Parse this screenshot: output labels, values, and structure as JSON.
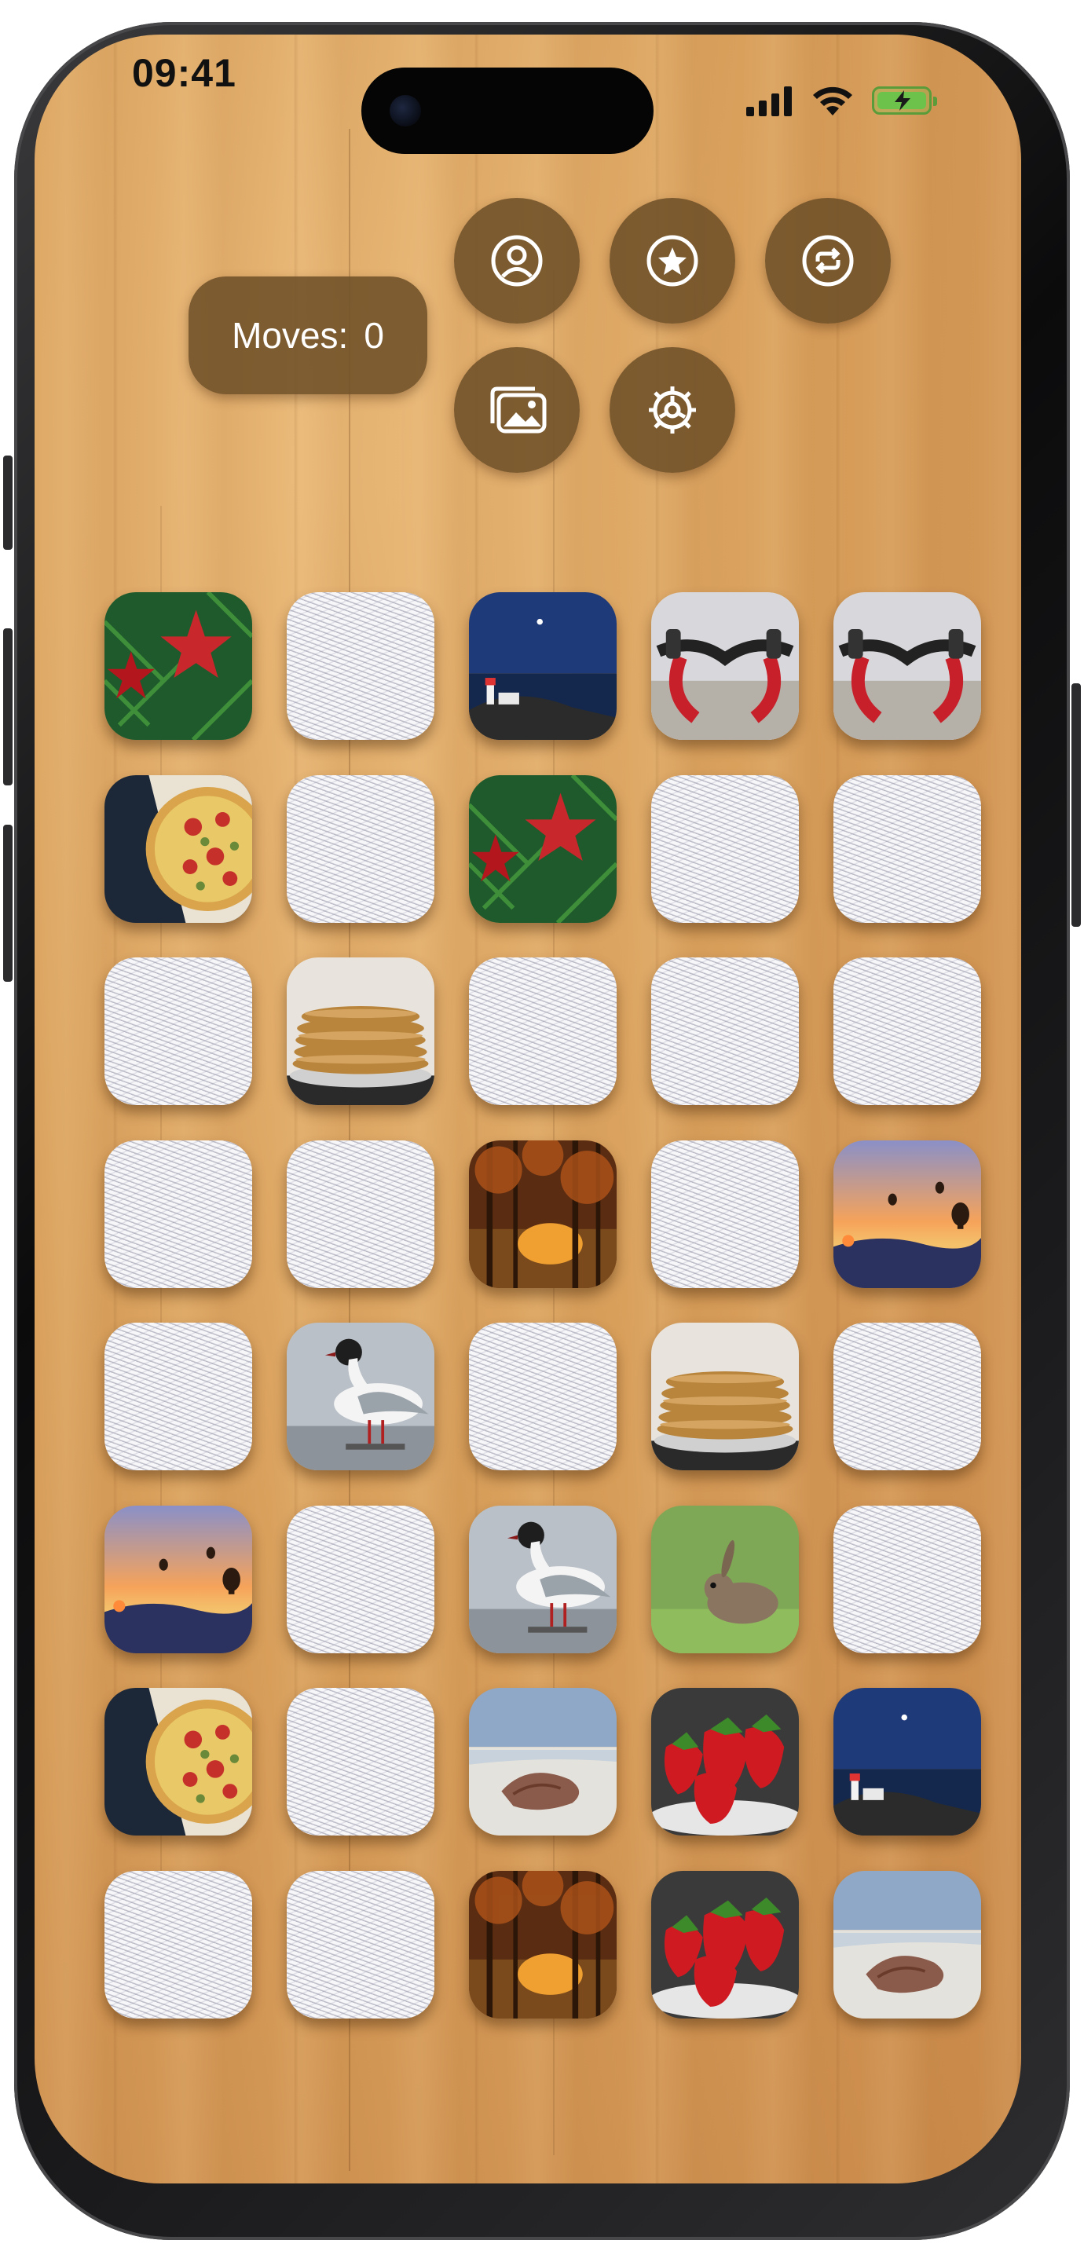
{
  "status_bar": {
    "time": "09:41"
  },
  "game": {
    "moves_label": "Moves:",
    "moves_value": "0"
  },
  "toolbar": {
    "buttons": [
      {
        "id": "profile",
        "icon": "person-circle-icon"
      },
      {
        "id": "favorites",
        "icon": "star-circle-icon"
      },
      {
        "id": "restart",
        "icon": "arrows-cycle-icon"
      },
      {
        "id": "photos",
        "icon": "photo-stack-icon"
      },
      {
        "id": "settings",
        "icon": "gear-icon"
      }
    ]
  },
  "board": {
    "columns": 5,
    "rows": 8,
    "cards": [
      "christmas-ornaments",
      "back",
      "lighthouse",
      "bicycle-handlebar",
      "bicycle-handlebar",
      "pizza",
      "back",
      "christmas-ornaments",
      "back",
      "back",
      "back",
      "pancakes",
      "back",
      "back",
      "back",
      "back",
      "back",
      "autumn-forest",
      "back",
      "hot-air-balloons",
      "back",
      "seagull",
      "back",
      "pancakes",
      "back",
      "hot-air-balloons",
      "back",
      "seagull",
      "rabbit",
      "back",
      "pizza",
      "back",
      "seashell-beach",
      "strawberries",
      "lighthouse",
      "back",
      "back",
      "autumn-forest",
      "strawberries",
      "seashell-beach"
    ]
  },
  "colors": {
    "button_bg": "#6e5028",
    "wood": "#d9a05c"
  }
}
